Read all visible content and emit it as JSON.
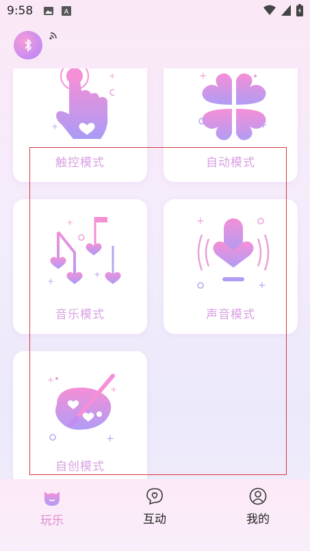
{
  "status_bar": {
    "time": "9:58"
  },
  "modes": [
    {
      "label": "触控模式",
      "icon": "touch-hand-icon"
    },
    {
      "label": "自动模式",
      "icon": "clover-heart-icon"
    },
    {
      "label": "音乐模式",
      "icon": "music-notes-icon"
    },
    {
      "label": "声音模式",
      "icon": "microphone-heart-icon"
    },
    {
      "label": "自创模式",
      "icon": "palette-brush-icon"
    }
  ],
  "bottom_nav": {
    "items": [
      {
        "label": "玩乐",
        "icon": "cat-face-icon",
        "active": true
      },
      {
        "label": "互动",
        "icon": "heart-chat-icon",
        "active": false
      },
      {
        "label": "我的",
        "icon": "user-profile-icon",
        "active": false
      }
    ]
  },
  "colors": {
    "accent_pink": "#e08ad0",
    "card_label": "#d9a0e3",
    "selection_border": "#d8333a"
  }
}
